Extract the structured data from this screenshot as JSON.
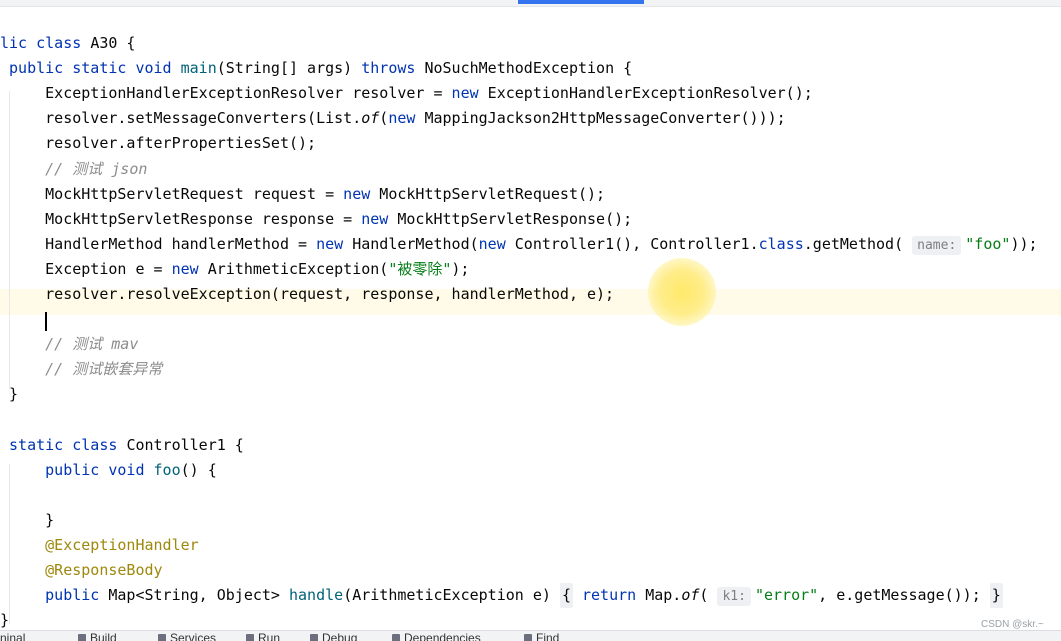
{
  "editor": {
    "lines": [
      {
        "segments": [
          {
            "t": "lic ",
            "k": "k"
          },
          {
            "t": "class ",
            "k": "k"
          },
          {
            "t": "A30 {",
            "k": ""
          }
        ]
      },
      {
        "segments": [
          {
            "t": " public static void ",
            "k": "k"
          },
          {
            "t": "main",
            "k": "m"
          },
          {
            "t": "(String[] args) ",
            "k": ""
          },
          {
            "t": "throws ",
            "k": "k"
          },
          {
            "t": "NoSuchMethodException {",
            "k": ""
          }
        ]
      },
      {
        "segments": [
          {
            "t": "     ExceptionHandlerExceptionResolver resolver = ",
            "k": ""
          },
          {
            "t": "new ",
            "k": "k"
          },
          {
            "t": "ExceptionHandlerExceptionResolver();",
            "k": ""
          }
        ]
      },
      {
        "segments": [
          {
            "t": "     resolver.setMessageConverters(List.",
            "k": ""
          },
          {
            "t": "of",
            "k": "sc"
          },
          {
            "t": "(",
            "k": ""
          },
          {
            "t": "new ",
            "k": "k"
          },
          {
            "t": "MappingJackson2HttpMessageConverter()));",
            "k": ""
          }
        ]
      },
      {
        "segments": [
          {
            "t": "     resolver.afterPropertiesSet();",
            "k": ""
          }
        ]
      },
      {
        "segments": [
          {
            "t": "     // 测试 json",
            "k": "c"
          }
        ]
      },
      {
        "segments": [
          {
            "t": "     MockHttpServletRequest request = ",
            "k": ""
          },
          {
            "t": "new ",
            "k": "k"
          },
          {
            "t": "MockHttpServletRequest();",
            "k": ""
          }
        ]
      },
      {
        "segments": [
          {
            "t": "     MockHttpServletResponse response = ",
            "k": ""
          },
          {
            "t": "new ",
            "k": "k"
          },
          {
            "t": "MockHttpServletResponse();",
            "k": ""
          }
        ]
      },
      {
        "segments": [
          {
            "t": "     HandlerMethod handlerMethod = ",
            "k": ""
          },
          {
            "t": "new ",
            "k": "k"
          },
          {
            "t": "HandlerMethod(",
            "k": ""
          },
          {
            "t": "new ",
            "k": "k"
          },
          {
            "t": "Controller1(), Controller1.",
            "k": ""
          },
          {
            "t": "class",
            "k": "k"
          },
          {
            "t": ".getMethod( ",
            "k": ""
          },
          {
            "t": "name:",
            "k": "hint"
          },
          {
            "t": "\"foo\"",
            "k": "s"
          },
          {
            "t": "));",
            "k": ""
          }
        ]
      },
      {
        "segments": [
          {
            "t": "     Exception e = ",
            "k": ""
          },
          {
            "t": "new ",
            "k": "k"
          },
          {
            "t": "ArithmeticException(",
            "k": ""
          },
          {
            "t": "\"被零除\"",
            "k": "s"
          },
          {
            "t": ");",
            "k": ""
          }
        ]
      },
      {
        "segments": [
          {
            "t": "     resolver.resolveException(request, response, handlerMethod, e);",
            "k": ""
          }
        ]
      },
      {
        "segments": [
          {
            "t": "",
            "k": ""
          }
        ]
      },
      {
        "segments": [
          {
            "t": "     // 测试 mav",
            "k": "c"
          }
        ]
      },
      {
        "segments": [
          {
            "t": "     // 测试嵌套异常",
            "k": "c"
          }
        ]
      },
      {
        "segments": [
          {
            "t": " }",
            "k": ""
          }
        ]
      },
      {
        "segments": [
          {
            "t": "",
            "k": ""
          }
        ]
      },
      {
        "segments": [
          {
            "t": " static class ",
            "k": "k"
          },
          {
            "t": "Controller1 {",
            "k": ""
          }
        ]
      },
      {
        "segments": [
          {
            "t": "     public void ",
            "k": "k"
          },
          {
            "t": "foo",
            "k": "m"
          },
          {
            "t": "() {",
            "k": ""
          }
        ]
      },
      {
        "segments": [
          {
            "t": "",
            "k": ""
          }
        ]
      },
      {
        "segments": [
          {
            "t": "     }",
            "k": ""
          }
        ]
      },
      {
        "segments": [
          {
            "t": "     @ExceptionHandler",
            "k": "a"
          }
        ]
      },
      {
        "segments": [
          {
            "t": "     @ResponseBody",
            "k": "a"
          }
        ]
      },
      {
        "segments": [
          {
            "t": "     public ",
            "k": "k"
          },
          {
            "t": "Map<String, Object> ",
            "k": ""
          },
          {
            "t": "handle",
            "k": "m"
          },
          {
            "t": "(ArithmeticException e) ",
            "k": ""
          },
          {
            "t": "{",
            "k": "fold"
          },
          {
            "t": " return ",
            "k": "k"
          },
          {
            "t": "Map.",
            "k": ""
          },
          {
            "t": "of",
            "k": "sc"
          },
          {
            "t": "( ",
            "k": ""
          },
          {
            "t": "k1:",
            "k": "hint"
          },
          {
            "t": "\"error\"",
            "k": "s"
          },
          {
            "t": ", e.getMessage()); ",
            "k": ""
          },
          {
            "t": "}",
            "k": "fold"
          }
        ]
      },
      {
        "segments": [
          {
            "t": "}",
            "k": ""
          }
        ]
      }
    ]
  },
  "toolbar": {
    "items": [
      "ninal",
      "Build",
      "Services",
      "Run",
      "Debug",
      "Dependencies",
      "Find"
    ]
  },
  "watermark": "CSDN @skr.~"
}
